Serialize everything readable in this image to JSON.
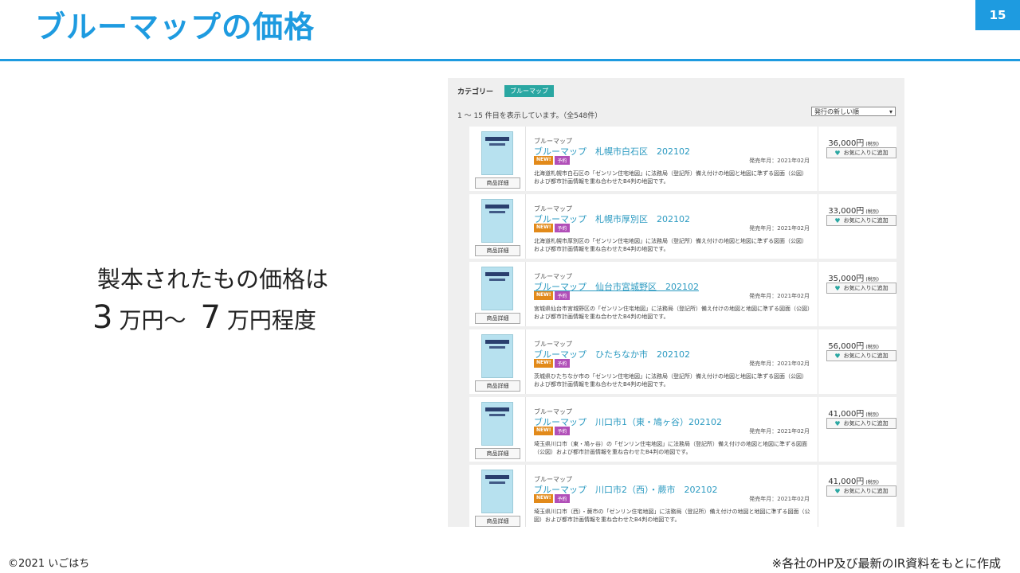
{
  "slide": {
    "title": "ブルーマップの価格",
    "page_number": "15",
    "body_line1": "製本されたもの価格は",
    "body_line2": {
      "num1": "3",
      "unit1": "万円～",
      "num2": "7",
      "unit2": "万円程度"
    },
    "copyright": "©2021 いごはち",
    "note": "※各社のHP及び最新のIR資料をもとに作成"
  },
  "shot": {
    "category_label": "カテゴリー",
    "category_tag": "ブルーマップ",
    "count_text": "1 ～ 15 件目を表示しています。（全548件）",
    "sort_value": "発行の新しい順",
    "detail_label": "商品詳細",
    "fav_label": "お気に入りに追加",
    "badge_new": "NEW!",
    "badge_yoyaku": "予約",
    "item_category": "ブルーマップ",
    "items": [
      {
        "name": "ブルーマップ　札幌市白石区　202102",
        "date": "発売年月：2021年02月",
        "desc": "北海道札幌市白石区の「ゼンリン住宅地図」に法務局（登記所）備え付けの地図と地図に準ずる図面（公図）および都市計画情報を重ね合わせたB4判の地図です。",
        "price": "36,000円",
        "tax": "(税別)"
      },
      {
        "name": "ブルーマップ　札幌市厚別区　202102",
        "date": "発売年月：2021年02月",
        "desc": "北海道札幌市厚別区の「ゼンリン住宅地図」に法務局（登記所）備え付けの地図と地図に準ずる図面（公図）および都市計画情報を重ね合わせたB4判の地図です。",
        "price": "33,000円",
        "tax": "(税別)"
      },
      {
        "name": "ブルーマップ　仙台市宮城野区　202102",
        "date": "発売年月：2021年02月",
        "desc": "宮城県仙台市宮城野区の「ゼンリン住宅地図」に法務局（登記所）備え付けの地図と地図に準ずる図面（公図）および都市計画情報を重ね合わせたB4判の地図です。",
        "price": "35,000円",
        "tax": "(税別)"
      },
      {
        "name": "ブルーマップ　ひたちなか市　202102",
        "date": "発売年月：2021年02月",
        "desc": "茨城県ひたちなか市の「ゼンリン住宅地図」に法務局（登記所）備え付けの地図と地図に準ずる図面（公図）および都市計画情報を重ね合わせたB4判の地図です。",
        "price": "56,000円",
        "tax": "(税別)"
      },
      {
        "name": "ブルーマップ　川口市1（東・鳩ヶ谷）202102",
        "date": "発売年月：2021年02月",
        "desc": "埼玉県川口市（東・鳩ヶ谷）の「ゼンリン住宅地図」に法務局（登記所）備え付けの地図と地図に準ずる図面（公図）および都市計画情報を重ね合わせたB4判の地図です。",
        "price": "41,000円",
        "tax": "(税別)"
      },
      {
        "name": "ブルーマップ　川口市2（西）・蕨市　202102",
        "date": "発売年月：2021年02月",
        "desc": "埼玉県川口市（西）・蕨市の「ゼンリン住宅地図」に法務局（登記所）備え付けの地図と地図に準ずる図面（公図）および都市計画情報を重ね合わせたB4判の地図です。",
        "price": "41,000円",
        "tax": "(税別)"
      }
    ]
  }
}
